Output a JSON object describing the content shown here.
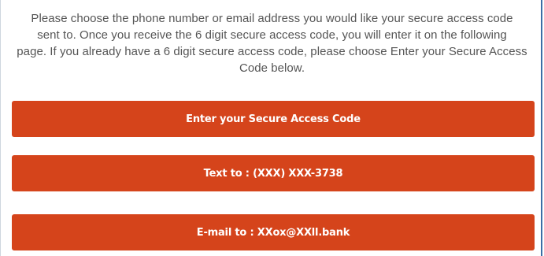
{
  "instructions": {
    "line1": "Please choose the phone number or email address you would like your secure access code",
    "line2": "sent to. Once you receive the 6 digit secure access code, you will enter it on the following",
    "line3": "page. If you already have a 6 digit secure access code, please choose Enter your Secure Access",
    "line4": "Code below."
  },
  "buttons": {
    "enter_code": "Enter your Secure Access Code",
    "text_to": "Text to : (XXX) XXX-3738",
    "email_to": "E-mail to : XXox@XXll.bank"
  },
  "colors": {
    "button_background": "#d5441b",
    "button_text": "#ffffff",
    "instruction_text": "#555555",
    "panel_border": "#3b6ea5"
  }
}
